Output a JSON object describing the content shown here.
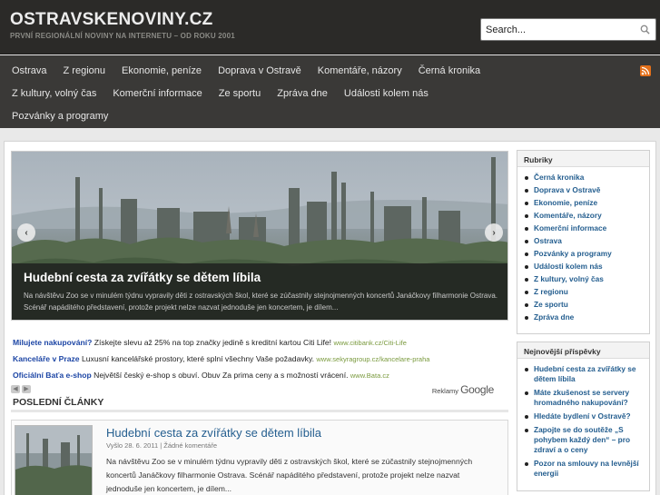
{
  "site": {
    "title": "OSTRAVSKENOVINY.CZ",
    "subtitle": "PRVNÍ REGIONÁLNÍ NOVINY NA INTERNETU – OD ROKU 2001"
  },
  "search": {
    "placeholder": "Search..."
  },
  "nav": {
    "row1": [
      "Ostrava",
      "Z regionu",
      "Ekonomie, peníze",
      "Doprava v Ostravě",
      "Komentáře, názory",
      "Černá kronika"
    ],
    "row2": [
      "Z kultury, volný čas",
      "Komerční informace",
      "Ze sportu",
      "Zpráva dne",
      "Události kolem nás"
    ],
    "row3": [
      "Pozvánky a programy"
    ]
  },
  "slider": {
    "title": "Hudební cesta za zvířátky se dětem líbila",
    "text": "Na návštěvu Zoo se v minulém týdnu vypravily děti z ostravských škol, které se zúčastnily stejnojmenných koncertů Janáčkovy filharmonie Ostrava.  Scénář napáditého představení, protože projekt nelze nazvat jednoduše jen koncertem, je dílem...",
    "prev": "‹",
    "next": "›"
  },
  "ads": [
    {
      "title": "Milujete nakupování?",
      "text": " Získejte slevu až 25% na top značky jedině s kreditní kartou Citi Life!",
      "url": "www.citibank.cz/Citi-Life"
    },
    {
      "title": "Kanceláře v Praze",
      "text": " Luxusní kancelářské prostory, které splní všechny Vaše požadavky.",
      "url": "www.sekyragroup.cz/kancelare-praha"
    },
    {
      "title": "Oficiální Baťa e-shop",
      "text": " Největší český e-shop s obuví. Obuv Za prima ceny a s možností vrácení.",
      "url": "www.Bata.cz"
    }
  ],
  "ads_label": {
    "prefix": "Reklamy ",
    "brand": "Google"
  },
  "section": {
    "title": "POSLEDNÍ ČLÁNKY"
  },
  "article": {
    "title": "Hudební cesta za zvířátky se dětem líbila",
    "meta": "Vyšlo 28. 6. 2011  |  Žádné komentáře",
    "text": "Na návštěvu Zoo se v minulém týdnu vypravily děti z ostravských škol, které se zúčastnily stejnojmenných koncertů Janáčkovy filharmonie Ostrava.  Scénář napáditého představení, protože projekt nelze nazvat jednoduše jen koncertem, je dílem..."
  },
  "sidebar": {
    "rubriky": {
      "title": "Rubriky",
      "items": [
        "Černá kronika",
        "Doprava v Ostravě",
        "Ekonomie, peníze",
        "Komentáře, názory",
        "Komerční informace",
        "Ostrava",
        "Pozvánky a programy",
        "Události kolem nás",
        "Z kultury, volný čas",
        "Z regionu",
        "Ze sportu",
        "Zpráva dne"
      ]
    },
    "posts": {
      "title": "Nejnovější příspěvky",
      "items": [
        "Hudební cesta za zvířátky se dětem líbila",
        "Máte zkušenost se servery hromadného nakupování?",
        "Hledáte bydlení v Ostravě?",
        "Zapojte se do soutěže „S pohybem každý den“ – pro zdraví a o ceny",
        "Pozor na smlouvy na levnější energii"
      ]
    }
  },
  "colors": {
    "header": "#2b2a28",
    "nav": "#3a3937",
    "link": "#245e8f",
    "ad_title": "#1d46a5",
    "ad_url": "#7a9a3e",
    "rss": "#e3701a"
  },
  "icons": {
    "search": "search-icon",
    "rss": "rss-icon",
    "slider_prev": "chevron-left-icon",
    "slider_next": "chevron-right-icon"
  }
}
